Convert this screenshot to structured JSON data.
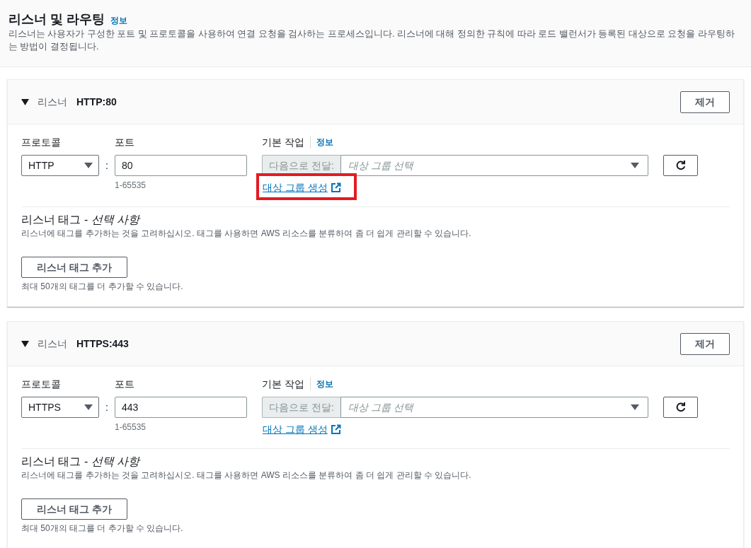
{
  "section": {
    "title": "리스너 및 라우팅",
    "info_link": "정보",
    "description": "리스너는 사용자가 구성한 포트 및 프로토콜을 사용하여 연결 요청을 검사하는 프로세스입니다. 리스너에 대해 정의한 규칙에 따라 로드 밸런서가 등록된 대상으로 요청을 라우팅하는 방법이 결정됩니다."
  },
  "listeners": [
    {
      "expanded": true,
      "label": "리스너",
      "name": "HTTP:80",
      "remove_button": "제거",
      "protocol": {
        "label": "프로토콜",
        "value": "HTTP"
      },
      "separator": ":",
      "port": {
        "label": "포트",
        "value": "80",
        "hint": "1-65535"
      },
      "default_action": {
        "label": "기본 작업",
        "info_link": "정보",
        "prefix": "다음으로 전달:",
        "placeholder": "대상 그룹 선택",
        "create_link": "대상 그룹 생성",
        "highlighted": true
      },
      "tags": {
        "title": "리스너 태그 - *선택 사항*",
        "description": "리스너에 태그를 추가하는 것을 고려하십시오. 태그를 사용하면 AWS 리소스를 분류하여 좀 더 쉽게 관리할 수 있습니다.",
        "add_button": "리스너 태그 추가",
        "limit_note": "최대 50개의 태그를 더 추가할 수 있습니다."
      }
    },
    {
      "expanded": true,
      "label": "리스너",
      "name": "HTTPS:443",
      "remove_button": "제거",
      "protocol": {
        "label": "프로토콜",
        "value": "HTTPS"
      },
      "separator": ":",
      "port": {
        "label": "포트",
        "value": "443",
        "hint": "1-65535"
      },
      "default_action": {
        "label": "기본 작업",
        "info_link": "정보",
        "prefix": "다음으로 전달:",
        "placeholder": "대상 그룹 선택",
        "create_link": "대상 그룹 생성",
        "highlighted": false
      },
      "tags": {
        "title": "리스너 태그 - *선택 사항*",
        "description": "리스너에 태그를 추가하는 것을 고려하십시오. 태그를 사용하면 AWS 리소스를 분류하여 좀 더 쉽게 관리할 수 있습니다.",
        "add_button": "리스너 태그 추가",
        "limit_note": "최대 50개의 태그를 더 추가할 수 있습니다."
      }
    }
  ]
}
